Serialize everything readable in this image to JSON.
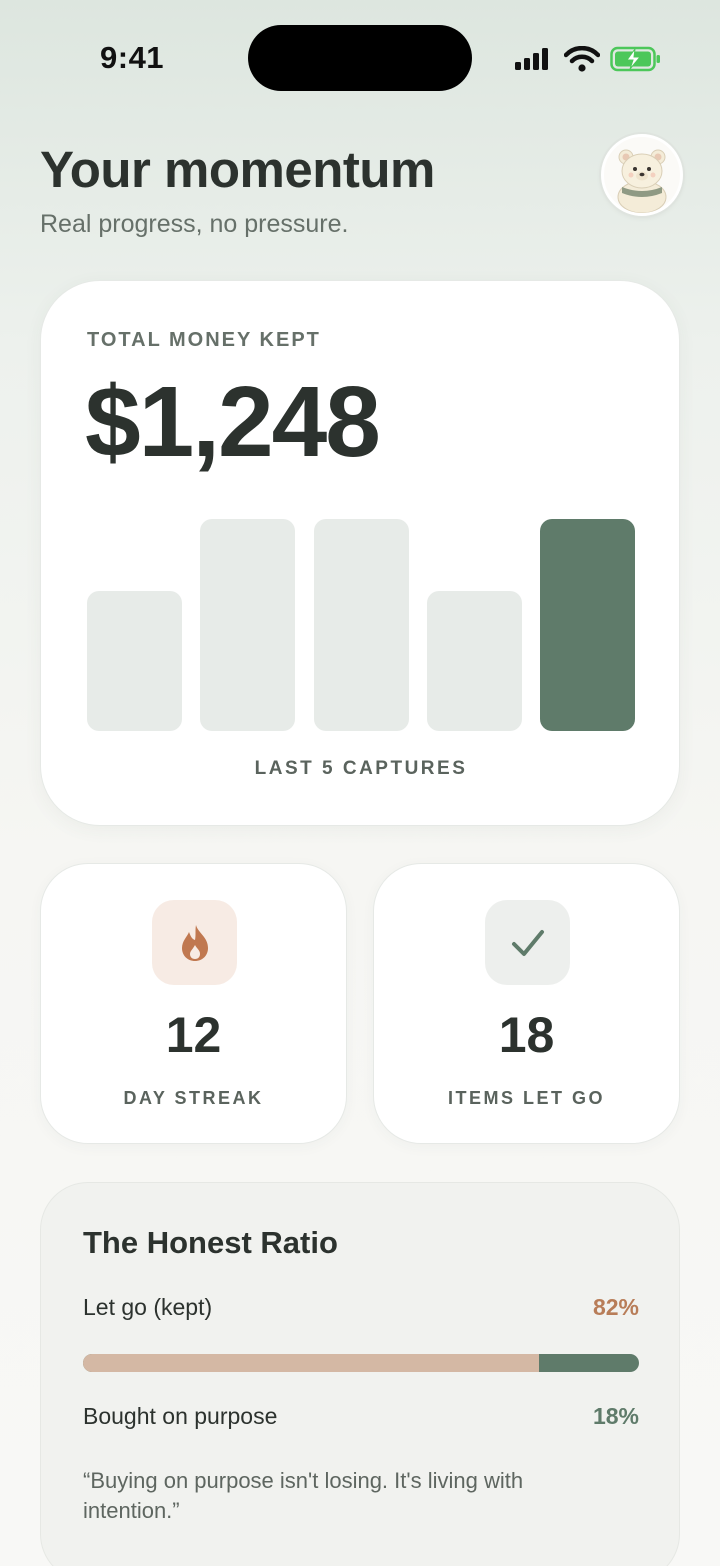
{
  "status_bar": {
    "time": "9:41",
    "icons": [
      "signal-icon",
      "wifi-icon",
      "battery-charging-icon"
    ]
  },
  "header": {
    "title": "Your momentum",
    "subtitle": "Real progress, no pressure.",
    "avatar_icon": "polar-bear-avatar-icon"
  },
  "money_card": {
    "label": "TOTAL MONEY KEPT",
    "value": "$1,248",
    "bars_caption": "LAST 5 CAPTURES"
  },
  "chart_data": {
    "type": "bar",
    "categories": [
      "1",
      "2",
      "3",
      "4",
      "5"
    ],
    "values": [
      0.66,
      1.0,
      1.0,
      0.66,
      1.0
    ],
    "highlight_index": 4,
    "colors": {
      "bar": "#e7ebe8",
      "highlight": "#5f7b6a"
    }
  },
  "stats": {
    "streak": {
      "value": "12",
      "label": "DAY STREAK",
      "icon": "flame-icon",
      "icon_bg": "#f7ebe4",
      "icon_color": "#c07850"
    },
    "let_go": {
      "value": "18",
      "label": "ITEMS LET GO",
      "icon": "checkmark-icon",
      "icon_bg": "#edefed",
      "icon_color": "#5f7b6a"
    }
  },
  "ratio": {
    "title": "The Honest Ratio",
    "let_go_label": "Let go (kept)",
    "let_go_pct": "82%",
    "let_go_fraction": 0.82,
    "bought_label": "Bought on purpose",
    "bought_pct": "18%",
    "quote": "“Buying on purpose isn't losing. It's living with intention.”"
  },
  "colors": {
    "accent_green": "#5f7b6a",
    "accent_tan": "#d4b8a4",
    "accent_orange": "#b87d58",
    "text_dark": "#2c322e"
  }
}
